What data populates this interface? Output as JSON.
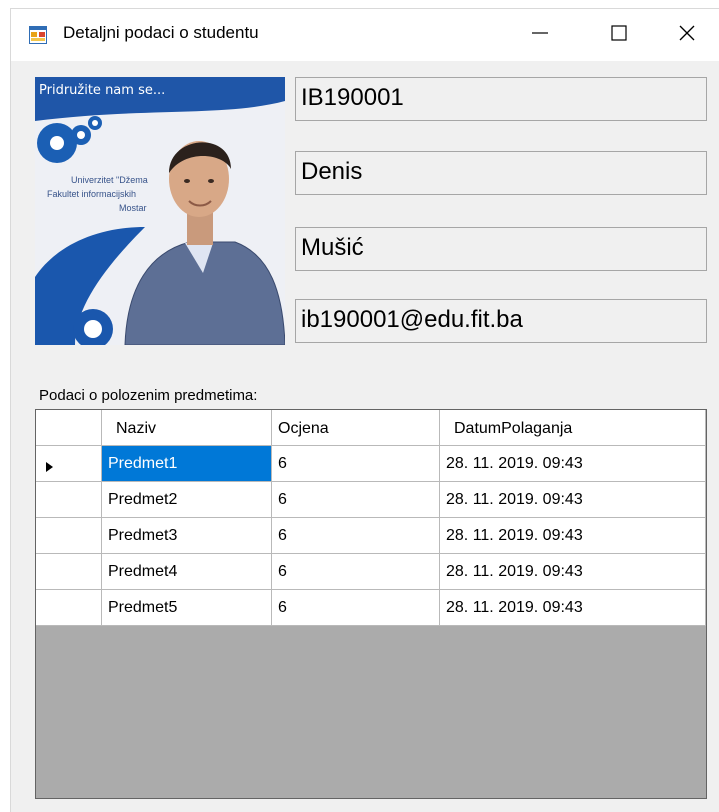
{
  "window": {
    "title": "Detaljni podaci o studentu"
  },
  "photo": {
    "caption": "Pridružite nam se...",
    "banner_line1": "Univerzitet \"Džema",
    "banner_line2": "Fakultet informacijskih",
    "banner_line3": "Mostar"
  },
  "student": {
    "index": "IB190001",
    "first_name": "Denis",
    "last_name": "Mušić",
    "email": "ib190001@edu.fit.ba"
  },
  "grid": {
    "label": "Podaci o polozenim predmetima:",
    "columns": [
      "Naziv",
      "Ocjena",
      "DatumPolaganja"
    ],
    "rows": [
      {
        "naziv": "Predmet1",
        "ocjena": "6",
        "datum": "28. 11. 2019. 09:43"
      },
      {
        "naziv": "Predmet2",
        "ocjena": "6",
        "datum": "28. 11. 2019. 09:43"
      },
      {
        "naziv": "Predmet3",
        "ocjena": "6",
        "datum": "28. 11. 2019. 09:43"
      },
      {
        "naziv": "Predmet4",
        "ocjena": "6",
        "datum": "28. 11. 2019. 09:43"
      },
      {
        "naziv": "Predmet5",
        "ocjena": "6",
        "datum": "28. 11. 2019. 09:43"
      }
    ]
  },
  "colors": {
    "selection": "#0078d7",
    "grid_background": "#ababab",
    "window_background": "#f0f0f0"
  },
  "icons": {
    "app": "form-icon",
    "minimize": "minimize-icon",
    "maximize": "maximize-icon",
    "close": "close-icon",
    "current_row": "row-pointer-icon"
  }
}
